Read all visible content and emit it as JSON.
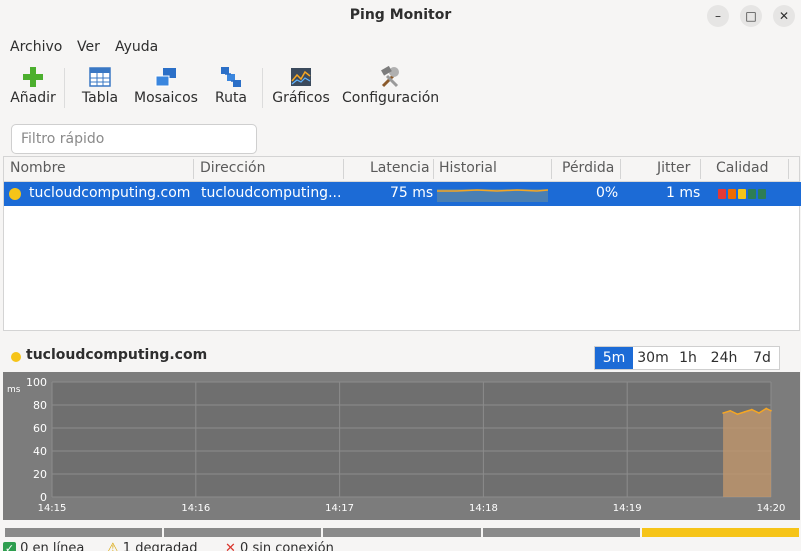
{
  "window": {
    "title": "Ping Monitor",
    "controls": [
      "–",
      "□",
      "✕"
    ]
  },
  "menu": [
    "Archivo",
    "Ver",
    "Ayuda"
  ],
  "toolbar": {
    "add": "Añadir",
    "table": "Tabla",
    "tiles": "Mosaicos",
    "route": "Ruta",
    "graphs": "Gráficos",
    "settings": "Configuración"
  },
  "filter": {
    "placeholder": "Filtro rápido",
    "value": ""
  },
  "table": {
    "columns": [
      "Nombre",
      "Dirección",
      "Latencia",
      "Historial",
      "Pérdida",
      "Jitter",
      "Calidad"
    ],
    "rows": [
      {
        "status_color": "#f6c418",
        "name": "tucloudcomputing.com",
        "address": "tucloudcomputing...",
        "latency": "75 ms",
        "loss": "0%",
        "jitter": "1 ms",
        "quality_colors": [
          "#e53935",
          "#ef6c00",
          "#f6c418",
          "#2e7d55",
          "#2e7d55"
        ]
      }
    ]
  },
  "detail": {
    "host": "tucloudcomputing.com",
    "dot_color": "#f6c418"
  },
  "ranges": [
    {
      "label": "5m",
      "active": true
    },
    {
      "label": "30m",
      "active": false
    },
    {
      "label": "1h",
      "active": false
    },
    {
      "label": "24h",
      "active": false
    },
    {
      "label": "7d",
      "active": false
    }
  ],
  "chart_data": {
    "type": "area",
    "ylabel": "ms",
    "ylim": [
      0,
      100
    ],
    "yticks": [
      "100",
      "80",
      "60",
      "40",
      "20",
      "0"
    ],
    "xticks": [
      "14:15",
      "14:16",
      "14:17",
      "14:18",
      "14:19",
      "14:20"
    ],
    "grid": true,
    "series": [
      {
        "color": "#f5a623",
        "x": [
          "14:19:40",
          "14:19:43",
          "14:19:46",
          "14:19:49",
          "14:19:52",
          "14:19:55",
          "14:19:58",
          "14:20:00"
        ],
        "values": [
          73,
          75,
          72,
          74,
          76,
          73,
          77,
          75
        ]
      }
    ]
  },
  "timeline": {
    "segments": [
      {
        "color": "#8a8a8a"
      },
      {
        "color": "#8a8a8a"
      },
      {
        "color": "#8a8a8a"
      },
      {
        "color": "#8a8a8a"
      },
      {
        "color": "#f6c418"
      }
    ]
  },
  "status": {
    "online": "0 en línea",
    "degraded": "1 degradad",
    "offline": "0 sin conexión"
  },
  "colors": {
    "accent": "#1c6bd6",
    "online": "#2e9e4f",
    "degraded": "#f6c418",
    "offline": "#d9342b"
  }
}
